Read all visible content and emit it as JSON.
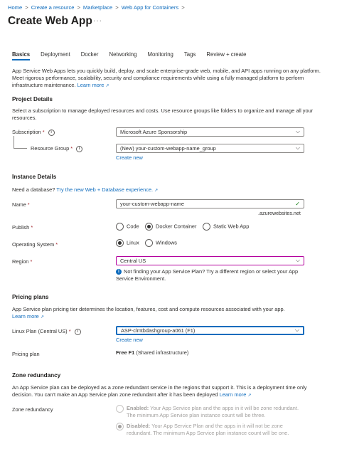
{
  "breadcrumb": [
    "Home",
    "Create a resource",
    "Marketplace",
    "Web App for Containers"
  ],
  "page": {
    "title": "Create Web App",
    "more": "···"
  },
  "tabs": [
    "Basics",
    "Deployment",
    "Docker",
    "Networking",
    "Monitoring",
    "Tags",
    "Review + create"
  ],
  "intro": {
    "text": "App Service Web Apps lets you quickly build, deploy, and scale enterprise-grade web, mobile, and API apps running on any platform. Meet rigorous performance, scalability, security and compliance requirements while using a fully managed platform to perform infrastructure maintenance.",
    "link": "Learn more"
  },
  "project": {
    "heading": "Project Details",
    "desc": "Select a subscription to manage deployed resources and costs. Use resource groups like folders to organize and manage all your resources.",
    "subscription_label": "Subscription",
    "subscription_value": "Microsoft Azure Sponsorship",
    "rg_label": "Resource Group",
    "rg_value": "(New) your-custom-webapp-name_group",
    "create_new": "Create new"
  },
  "instance": {
    "heading": "Instance Details",
    "need_db": "Need a database?",
    "db_link": "Try the new Web + Database experience.",
    "name_label": "Name",
    "name_value": "your-custom-webapp-name",
    "name_suffix": ".azurewebsites.net",
    "publish_label": "Publish",
    "publish_options": [
      "Code",
      "Docker Container",
      "Static Web App"
    ],
    "os_label": "Operating System",
    "os_options": [
      "Linux",
      "Windows"
    ],
    "region_label": "Region",
    "region_value": "Central US",
    "region_note": "Not finding your App Service Plan? Try a different region or select your App Service Environment."
  },
  "pricing": {
    "heading": "Pricing plans",
    "desc": "App Service plan pricing tier determines the location, features, cost and compute resources associated with your app.",
    "learn_more": "Learn more",
    "plan_label": "Linux Plan (Central US)",
    "plan_value": "ASP-clmtbdashgroup-a061 (F1)",
    "create_new": "Create new",
    "pricing_label": "Pricing plan",
    "pricing_tier": "Free F1",
    "pricing_desc": "(Shared infrastructure)"
  },
  "zone": {
    "heading": "Zone redundancy",
    "desc": "An App Service plan can be deployed as a zone redundant service in the regions that support it. This is a deployment time only decision. You can't make an App Service plan zone redundant after it has been deployed",
    "learn_more": "Learn more",
    "label": "Zone redundancy",
    "enabled_title": "Enabled:",
    "enabled_desc": "Your App Service plan and the apps in it will be zone redundant. The minimum App Service plan instance count will be three.",
    "disabled_title": "Disabled:",
    "disabled_desc": "Your App Service Plan and the apps in it will not be zone redundant. The minimum App Service plan instance count will be one."
  }
}
